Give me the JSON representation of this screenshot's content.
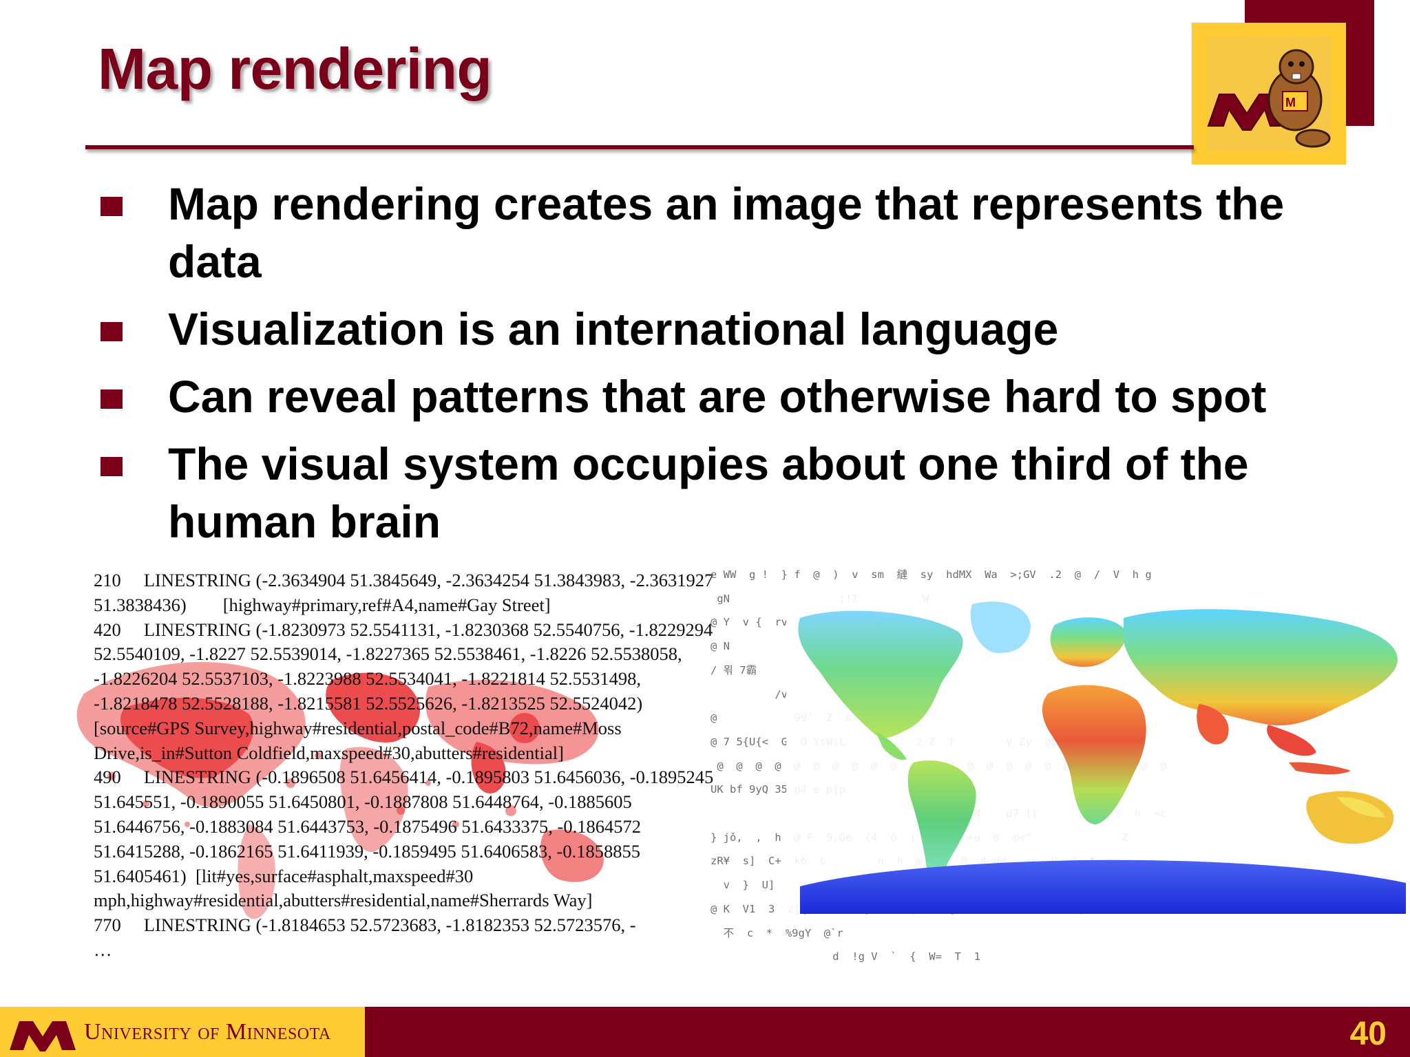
{
  "slide": {
    "title": "Map rendering",
    "bullets": [
      "Map rendering creates an image that represents the data",
      "Visualization is an international language",
      "Can reveal patterns that are otherwise hard to spot",
      "The visual system occupies about one third of the human brain"
    ],
    "code_sample": "210     LINESTRING (-2.3634904 51.3845649, -2.3634254 51.3843983, -2.3631927 51.3838436)        [highway#primary,ref#A4,name#Gay Street]\n420     LINESTRING (-1.8230973 52.5541131, -1.8230368 52.5540756, -1.8229294 52.5540109, -1.8227 52.5539014, -1.8227365 52.5538461, -1.8226 52.5538058, -1.8226204 52.5537103, -1.8223988 52.5534041, -1.8221814 52.5531498, -1.8218478 52.5528188, -1.8215581 52.5525626, -1.8213525 52.5524042) [source#GPS Survey,highway#residential,postal_code#B72,name#Moss Drive,is_in#Sutton Coldfield,maxspeed#30,abutters#residential]\n490     LINESTRING (-0.1896508 51.6456414, -0.1895803 51.6456036, -0.1895245 51.645551, -0.1890055 51.6450801, -0.1887808 51.6448764, -0.1885605 51.6446756, -0.1883084 51.6443753, -0.1875496 51.6433375, -0.1864572 51.6415288, -0.1862165 51.6411939, -0.1859495 51.6406583, -0.1858855 51.6405461)  [lit#yes,surface#asphalt,maxspeed#30 mph,highway#residential,abutters#residential,name#Sherrards Way]\n770     LINESTRING (-1.8184653 52.5723683, -1.8182353 52.5723576, -\n…",
    "garbage_text": "e WW  g !  } f  @  )  v  sm  縺  sy  hdMX  Wa  >;GV  .2  @  /  V  h g\n gN                 ;!I          W                         \n@ Y  v {  rv      UHM\n@ N\n/ 뫾 7霸\n          /v\n@            99'  Z  u $  @ @ šk                            R  $A @\n@ 7 5{U{<  G  O YsW;L           z Z  f        y Zy  @Lz  @  uW  @\n @  @  @  @  @  @  @  @  @  @  @  @  @  @  @  @  @  @  @  @  @  @  @  @\nUK bf 9yQ 35 g4 e p{p\n                                U= ] WMuxN    d7 [[      ]  @  $  h  =c\n} jǒ,  ,  h  @ F  9,Ge  {4  ô  |  A  c  +u  0  @<^              Z\nzR¥  s]  C+  k6  L        n  h  m   +  @  # gW   sy  U  8  ¶    \n  v  }  U]    @`d  g F  ++^D  1  Q  6xg  x  y  1  T  ]    ^  n j   X  @\n@ K  V1  3  z[{  D  9  ~}  1c  ]  x  @  I$  5  c  uU7  ~ [\n  不  c  *  %9gY  @`r\n                   d  !g V  `  {  W=  T  1\n> H  0            c5  #  U1\n                                                                    W]\nZ?  1U  v6  xf  Z  Rzj  ;  @ O Z7  j  z  V  vc  3Q{D_S]  .  o;  #@<2}\n  _^\\  TG  U1  3  U  D  @ d    ^<  zw  Zk5  鴌  é  ) f徜 /y  @  ,P{1  3  i\n  v  \\  Krj  \\  {  f  Q  E   H  P  H  WK>  ye^  '  ss]  GxM   w WU]}  w\\"
  },
  "footer": {
    "university": "University of Minnesota",
    "page_number": "40"
  },
  "colors": {
    "maroon": "#7a0019",
    "gold": "#ffcc33"
  }
}
